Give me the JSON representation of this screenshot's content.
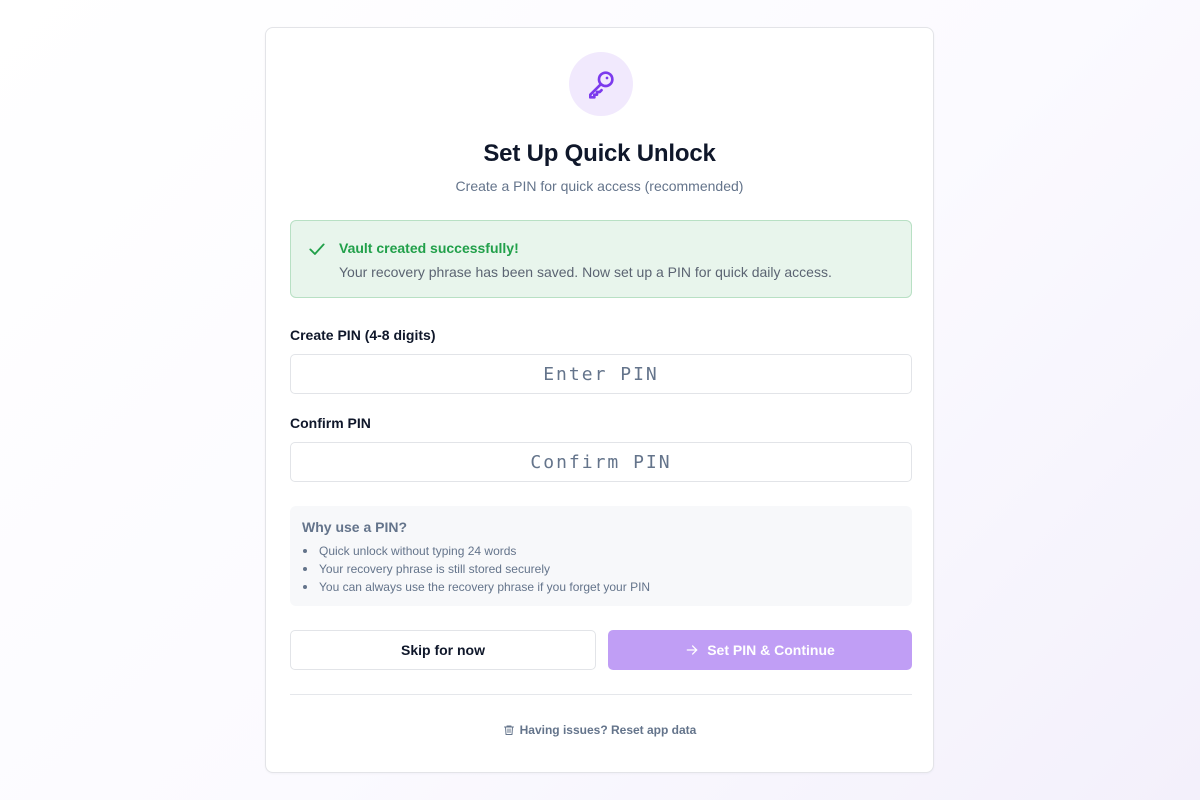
{
  "header": {
    "icon": "key-icon",
    "title": "Set Up Quick Unlock",
    "subtitle": "Create a PIN for quick access (recommended)"
  },
  "success_alert": {
    "icon": "check-icon",
    "title": "Vault created successfully!",
    "message": "Your recovery phrase has been saved. Now set up a PIN for quick daily access."
  },
  "form": {
    "pin_label": "Create PIN (4-8 digits)",
    "pin_placeholder": "Enter PIN",
    "pin_value": "",
    "confirm_label": "Confirm PIN",
    "confirm_placeholder": "Confirm PIN",
    "confirm_value": ""
  },
  "info_box": {
    "title": "Why use a PIN?",
    "items": [
      "Quick unlock without typing 24 words",
      "Your recovery phrase is still stored securely",
      "You can always use the recovery phrase if you forget your PIN"
    ]
  },
  "actions": {
    "skip_label": "Skip for now",
    "continue_label": "Set PIN & Continue",
    "continue_icon": "arrow-right-icon"
  },
  "footer": {
    "reset_icon": "trash-icon",
    "reset_label": "Having issues? Reset app data"
  },
  "colors": {
    "accent": "#7c3aed",
    "accent_disabled": "#c09ef5",
    "success": "#21a04a",
    "success_bg": "#e8f5ec"
  }
}
